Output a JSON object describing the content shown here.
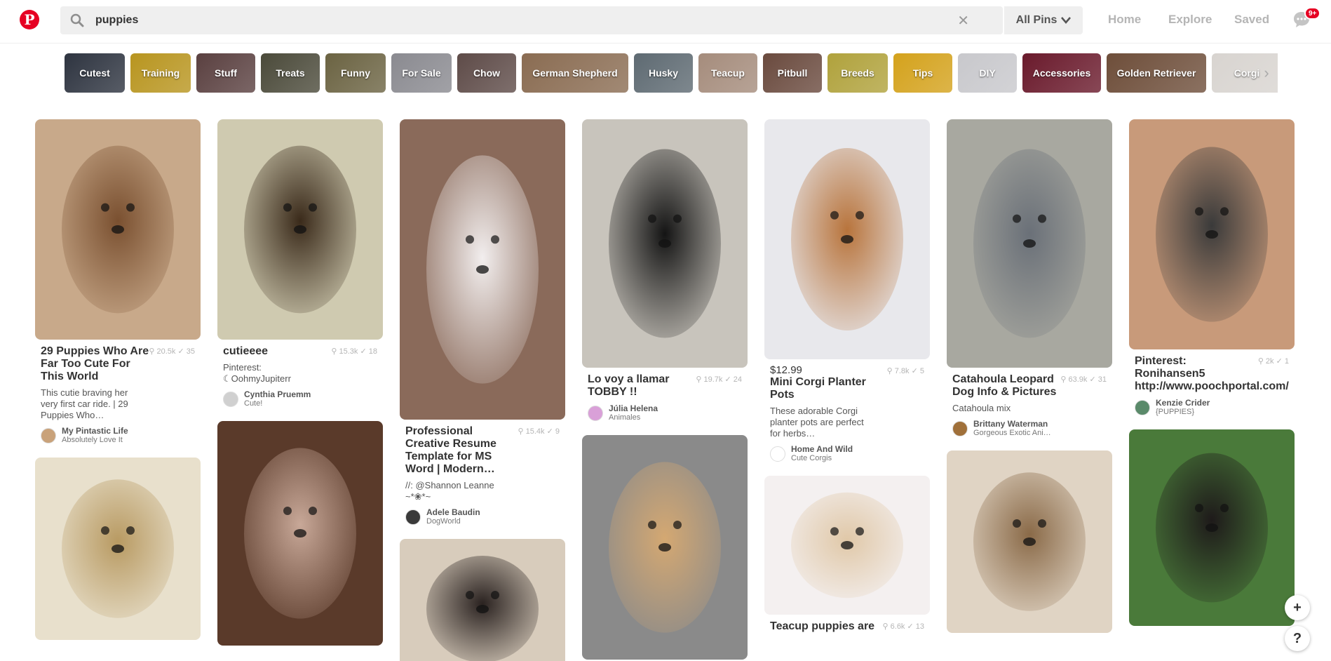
{
  "header": {
    "logo_letter": "P",
    "search": {
      "value": "puppies",
      "clear_symbol": "✕",
      "icon": "search-icon"
    },
    "scope": {
      "label": "All Pins",
      "icon": "chevron-down-icon"
    },
    "nav": {
      "home": "Home",
      "explore": "Explore",
      "saved": "Saved"
    },
    "messages": {
      "badge": "9+",
      "icon": "chat-bubble-icon"
    },
    "accent_color": "#e60023"
  },
  "chips": [
    {
      "label": "Cutest",
      "color": "#2e3440"
    },
    {
      "label": "Training",
      "color": "#b8951f"
    },
    {
      "label": "Stuff",
      "color": "#5a4040"
    },
    {
      "label": "Treats",
      "color": "#4b4a3a"
    },
    {
      "label": "Funny",
      "color": "#6b6342"
    },
    {
      "label": "For Sale",
      "color": "#8a8a90"
    },
    {
      "label": "Chow",
      "color": "#5e4b48"
    },
    {
      "label": "German Shepherd",
      "color": "#8a6c52"
    },
    {
      "label": "Husky",
      "color": "#5e6a72"
    },
    {
      "label": "Teacup",
      "color": "#a58c7c"
    },
    {
      "label": "Pitbull",
      "color": "#6a4a3e"
    },
    {
      "label": "Breeds",
      "color": "#b0a23c"
    },
    {
      "label": "Tips",
      "color": "#d4a21c"
    },
    {
      "label": "DIY",
      "color": "#c8c8cc"
    },
    {
      "label": "Accessories",
      "color": "#6a1a2c"
    },
    {
      "label": "Golden Retriever",
      "color": "#6e4e3a"
    },
    {
      "label": "Corgi",
      "color": "#d8d4d0"
    }
  ],
  "chips_next_symbol": "›",
  "columns": [
    {
      "pins": [
        {
          "img_h": 314,
          "img_a": "#c8a98a",
          "img_b": "#7a5030",
          "title": "29 Puppies Who Are Far Too Cute For This World",
          "stats": "⚲ 20.5k ✓ 35",
          "desc": "This cutie braving her very first car ride. | 29 Puppies Who…",
          "owner": "My Pintastic Life",
          "board": "Absolutely Love It",
          "av": "#c9a27a"
        },
        {
          "img_h": 260,
          "img_a": "#e8e0cc",
          "img_b": "#b89a62",
          "title": "",
          "stats": "",
          "desc": "",
          "owner": "",
          "board": "",
          "av": ""
        }
      ]
    },
    {
      "pins": [
        {
          "img_h": 314,
          "img_a": "#cfcab0",
          "img_b": "#3a2a1a",
          "title": "cutieeee",
          "stats": "⚲ 15.3k ✓ 18",
          "desc": "Pinterest: ☾OohmyJupiterr",
          "owner": "Cynthia Pruemm",
          "board": "Cute!",
          "av": "#d0d0d0"
        },
        {
          "img_h": 320,
          "img_a": "#5a3a2a",
          "img_b": "#c8a898",
          "title": "",
          "stats": "",
          "desc": "",
          "owner": "",
          "board": "",
          "av": ""
        }
      ]
    },
    {
      "pins": [
        {
          "img_h": 428,
          "img_a": "#8a6a5a",
          "img_b": "#f2eeee",
          "title": "Professional Creative Resume Template for MS Word | Modern…",
          "stats": "⚲ 15.4k ✓ 9",
          "desc": "//: @Shannon Leanne ~*❀*~",
          "owner": "Adele Baudin",
          "board": "DogWorld",
          "av": "#3a3a3a"
        },
        {
          "img_h": 200,
          "img_a": "#d8ccbc",
          "img_b": "#2a2220",
          "title": "",
          "stats": "",
          "desc": "",
          "owner": "",
          "board": "",
          "av": ""
        }
      ]
    },
    {
      "pins": [
        {
          "img_h": 354,
          "img_a": "#c8c4bc",
          "img_b": "#141414",
          "title": "Lo voy a llamar TOBBY !!",
          "stats": "⚲ 19.7k ✓ 24",
          "desc": "",
          "owner": "Júlia Helena",
          "board": "Animales",
          "av": "#d9a0d8"
        },
        {
          "img_h": 320,
          "img_a": "#8a8a8a",
          "img_b": "#d4a872",
          "title": "",
          "stats": "",
          "desc": "",
          "owner": "",
          "board": "",
          "av": ""
        }
      ]
    },
    {
      "pins": [
        {
          "img_h": 342,
          "img_a": "#e8e8ec",
          "img_b": "#b8743c",
          "price": "$12.99",
          "title": "Mini Corgi Planter Pots",
          "stats": "⚲ 7.8k ✓ 5",
          "desc": "These adorable Corgi planter pots are perfect for herbs…",
          "owner": "Home And Wild",
          "board": "Cute Corgis",
          "av": "#ffffff"
        },
        {
          "img_h": 198,
          "img_a": "#f4f0f0",
          "img_b": "#e0c8a8",
          "title": "Teacup puppies are",
          "stats": "⚲ 6.6k ✓ 13",
          "desc": "",
          "owner": "",
          "board": "",
          "av": ""
        }
      ]
    },
    {
      "pins": [
        {
          "img_h": 354,
          "img_a": "#a8a8a0",
          "img_b": "#6a7078",
          "title": "Catahoula Leopard Dog Info & Pictures",
          "stats": "⚲ 63.9k ✓ 31",
          "desc": "Catahoula mix",
          "owner": "Brittany Waterman",
          "board": "Gorgeous Exotic Ani…",
          "av": "#a0703a"
        },
        {
          "img_h": 260,
          "img_a": "#e0d4c4",
          "img_b": "#8a6a48",
          "title": "",
          "stats": "",
          "desc": "",
          "owner": "",
          "board": "",
          "av": ""
        }
      ]
    },
    {
      "pins": [
        {
          "img_h": 328,
          "img_a": "#c89a7a",
          "img_b": "#3a3a3a",
          "title": "Pinterest: Ronihansen5 http://www.poochportal.com/",
          "stats": "⚲ 2k ✓ 1",
          "desc": "",
          "owner": "Kenzie Crider",
          "board": "{PUPPIES}",
          "av": "#5a8a6a"
        },
        {
          "img_h": 280,
          "img_a": "#4a7a3a",
          "img_b": "#1e1a1a",
          "title": "",
          "stats": "",
          "desc": "",
          "owner": "",
          "board": "",
          "av": ""
        }
      ]
    }
  ],
  "fab": {
    "add": "+",
    "help": "?"
  }
}
